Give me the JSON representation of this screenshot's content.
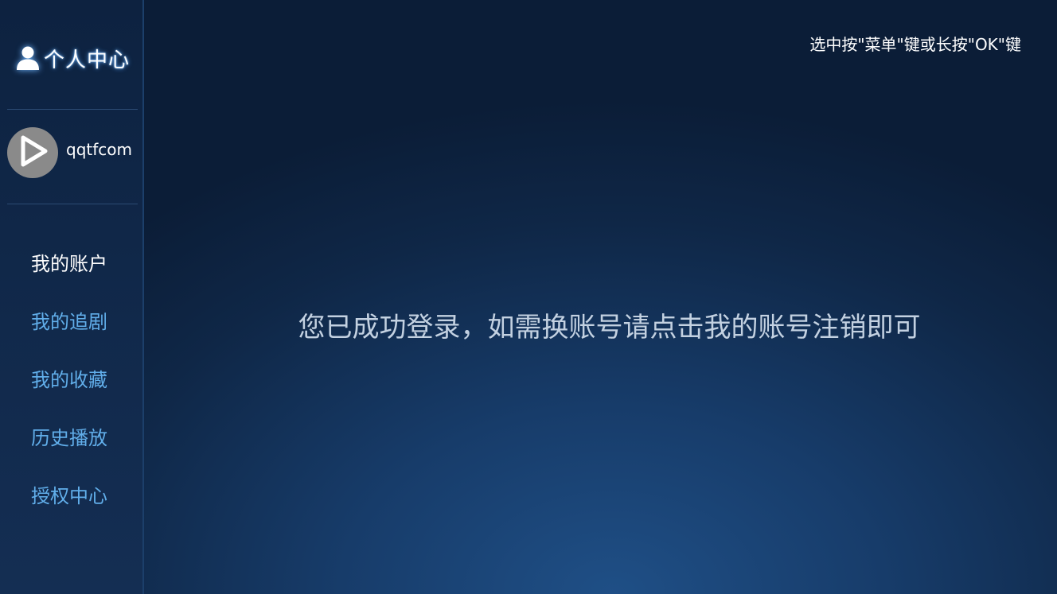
{
  "sidebar": {
    "header": {
      "title": "个人中心",
      "icon": "person-icon"
    },
    "profile": {
      "username": "qqtfcom",
      "avatar_icon": "play-logo-icon"
    },
    "items": [
      {
        "label": "我的账户",
        "active": true
      },
      {
        "label": "我的追剧",
        "active": false
      },
      {
        "label": "我的收藏",
        "active": false
      },
      {
        "label": "历史播放",
        "active": false
      },
      {
        "label": "授权中心",
        "active": false
      }
    ]
  },
  "main": {
    "hint": "选中按\"菜单\"键或长按\"OK\"键",
    "message": "您已成功登录，如需换账号请点击我的账号注销即可"
  },
  "colors": {
    "active_item": "#ffffff",
    "inactive_item": "#61aeea",
    "message_text": "#c3d1e1",
    "glow": "#5aa8ff"
  }
}
